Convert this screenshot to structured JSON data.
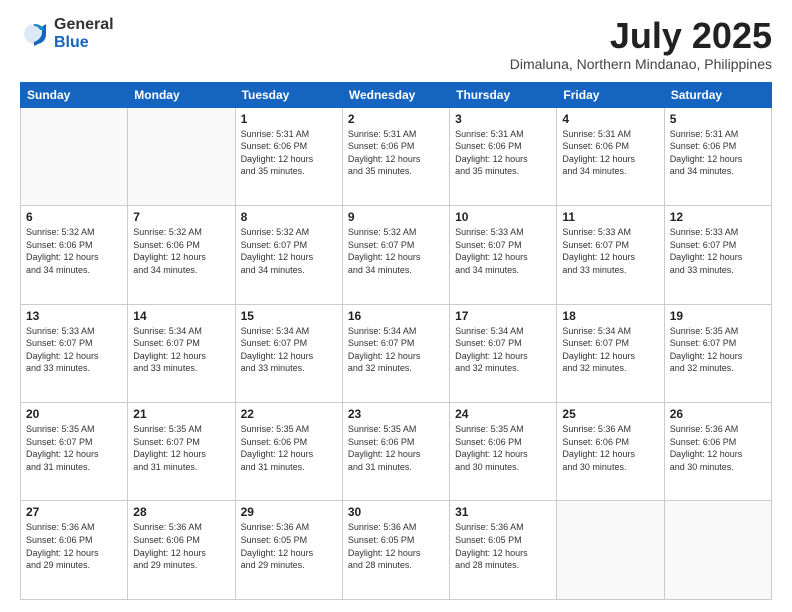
{
  "header": {
    "logo_general": "General",
    "logo_blue": "Blue",
    "month_year": "July 2025",
    "location": "Dimaluna, Northern Mindanao, Philippines"
  },
  "weekdays": [
    "Sunday",
    "Monday",
    "Tuesday",
    "Wednesday",
    "Thursday",
    "Friday",
    "Saturday"
  ],
  "weeks": [
    [
      {
        "day": "",
        "info": ""
      },
      {
        "day": "",
        "info": ""
      },
      {
        "day": "1",
        "info": "Sunrise: 5:31 AM\nSunset: 6:06 PM\nDaylight: 12 hours\nand 35 minutes."
      },
      {
        "day": "2",
        "info": "Sunrise: 5:31 AM\nSunset: 6:06 PM\nDaylight: 12 hours\nand 35 minutes."
      },
      {
        "day": "3",
        "info": "Sunrise: 5:31 AM\nSunset: 6:06 PM\nDaylight: 12 hours\nand 35 minutes."
      },
      {
        "day": "4",
        "info": "Sunrise: 5:31 AM\nSunset: 6:06 PM\nDaylight: 12 hours\nand 34 minutes."
      },
      {
        "day": "5",
        "info": "Sunrise: 5:31 AM\nSunset: 6:06 PM\nDaylight: 12 hours\nand 34 minutes."
      }
    ],
    [
      {
        "day": "6",
        "info": "Sunrise: 5:32 AM\nSunset: 6:06 PM\nDaylight: 12 hours\nand 34 minutes."
      },
      {
        "day": "7",
        "info": "Sunrise: 5:32 AM\nSunset: 6:06 PM\nDaylight: 12 hours\nand 34 minutes."
      },
      {
        "day": "8",
        "info": "Sunrise: 5:32 AM\nSunset: 6:07 PM\nDaylight: 12 hours\nand 34 minutes."
      },
      {
        "day": "9",
        "info": "Sunrise: 5:32 AM\nSunset: 6:07 PM\nDaylight: 12 hours\nand 34 minutes."
      },
      {
        "day": "10",
        "info": "Sunrise: 5:33 AM\nSunset: 6:07 PM\nDaylight: 12 hours\nand 34 minutes."
      },
      {
        "day": "11",
        "info": "Sunrise: 5:33 AM\nSunset: 6:07 PM\nDaylight: 12 hours\nand 33 minutes."
      },
      {
        "day": "12",
        "info": "Sunrise: 5:33 AM\nSunset: 6:07 PM\nDaylight: 12 hours\nand 33 minutes."
      }
    ],
    [
      {
        "day": "13",
        "info": "Sunrise: 5:33 AM\nSunset: 6:07 PM\nDaylight: 12 hours\nand 33 minutes."
      },
      {
        "day": "14",
        "info": "Sunrise: 5:34 AM\nSunset: 6:07 PM\nDaylight: 12 hours\nand 33 minutes."
      },
      {
        "day": "15",
        "info": "Sunrise: 5:34 AM\nSunset: 6:07 PM\nDaylight: 12 hours\nand 33 minutes."
      },
      {
        "day": "16",
        "info": "Sunrise: 5:34 AM\nSunset: 6:07 PM\nDaylight: 12 hours\nand 32 minutes."
      },
      {
        "day": "17",
        "info": "Sunrise: 5:34 AM\nSunset: 6:07 PM\nDaylight: 12 hours\nand 32 minutes."
      },
      {
        "day": "18",
        "info": "Sunrise: 5:34 AM\nSunset: 6:07 PM\nDaylight: 12 hours\nand 32 minutes."
      },
      {
        "day": "19",
        "info": "Sunrise: 5:35 AM\nSunset: 6:07 PM\nDaylight: 12 hours\nand 32 minutes."
      }
    ],
    [
      {
        "day": "20",
        "info": "Sunrise: 5:35 AM\nSunset: 6:07 PM\nDaylight: 12 hours\nand 31 minutes."
      },
      {
        "day": "21",
        "info": "Sunrise: 5:35 AM\nSunset: 6:07 PM\nDaylight: 12 hours\nand 31 minutes."
      },
      {
        "day": "22",
        "info": "Sunrise: 5:35 AM\nSunset: 6:06 PM\nDaylight: 12 hours\nand 31 minutes."
      },
      {
        "day": "23",
        "info": "Sunrise: 5:35 AM\nSunset: 6:06 PM\nDaylight: 12 hours\nand 31 minutes."
      },
      {
        "day": "24",
        "info": "Sunrise: 5:35 AM\nSunset: 6:06 PM\nDaylight: 12 hours\nand 30 minutes."
      },
      {
        "day": "25",
        "info": "Sunrise: 5:36 AM\nSunset: 6:06 PM\nDaylight: 12 hours\nand 30 minutes."
      },
      {
        "day": "26",
        "info": "Sunrise: 5:36 AM\nSunset: 6:06 PM\nDaylight: 12 hours\nand 30 minutes."
      }
    ],
    [
      {
        "day": "27",
        "info": "Sunrise: 5:36 AM\nSunset: 6:06 PM\nDaylight: 12 hours\nand 29 minutes."
      },
      {
        "day": "28",
        "info": "Sunrise: 5:36 AM\nSunset: 6:06 PM\nDaylight: 12 hours\nand 29 minutes."
      },
      {
        "day": "29",
        "info": "Sunrise: 5:36 AM\nSunset: 6:05 PM\nDaylight: 12 hours\nand 29 minutes."
      },
      {
        "day": "30",
        "info": "Sunrise: 5:36 AM\nSunset: 6:05 PM\nDaylight: 12 hours\nand 28 minutes."
      },
      {
        "day": "31",
        "info": "Sunrise: 5:36 AM\nSunset: 6:05 PM\nDaylight: 12 hours\nand 28 minutes."
      },
      {
        "day": "",
        "info": ""
      },
      {
        "day": "",
        "info": ""
      }
    ]
  ]
}
